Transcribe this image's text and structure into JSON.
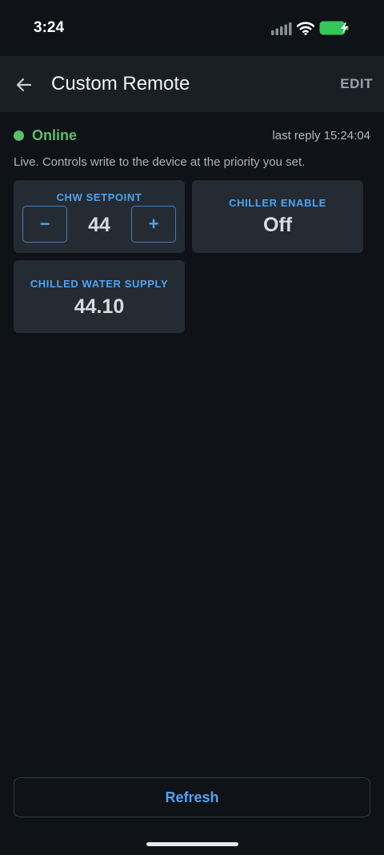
{
  "status_bar": {
    "time": "3:24",
    "icons": [
      "signal-icon",
      "wifi-icon",
      "battery-charging-icon"
    ],
    "battery_color": "#34c759"
  },
  "header": {
    "back_icon": "arrow-left-icon",
    "title": "Custom Remote",
    "edit_label": "EDIT"
  },
  "connection": {
    "status": "Online",
    "status_color": "#5bbf6a",
    "last_reply": "last reply 15:24:04"
  },
  "info_text": "Live. Controls write to the device at the priority you set.",
  "tiles": {
    "chw_setpoint": {
      "label": "CHW SETPOINT",
      "value": "44",
      "decrement_label": "−",
      "increment_label": "+"
    },
    "chiller_enable": {
      "label": "CHILLER ENABLE",
      "value": "Off"
    },
    "chilled_water_supply": {
      "label": "CHILLED WATER SUPPLY",
      "value": "44.10"
    }
  },
  "footer": {
    "refresh_label": "Refresh"
  },
  "colors": {
    "accent": "#4da3f0",
    "background": "#0f1216",
    "header": "#1a1f26",
    "tile": "#252b33"
  }
}
